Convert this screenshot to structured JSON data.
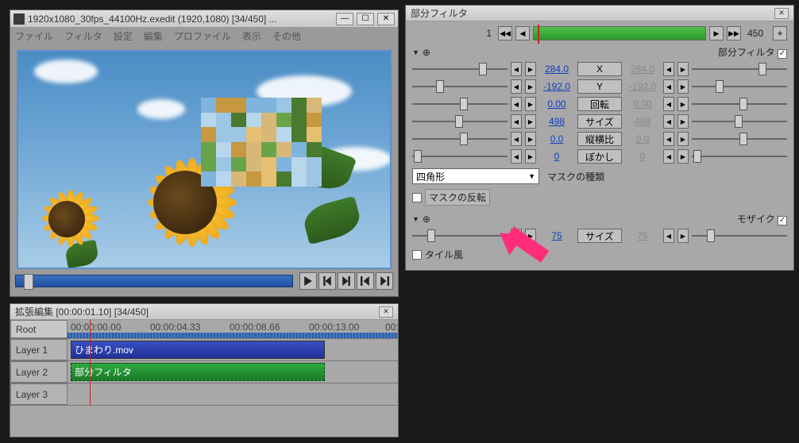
{
  "preview": {
    "title": "1920x1080_30fps_44100Hz.exedit (1920,1080) [34/450]  ...",
    "menu": [
      "ファイル",
      "フィルタ",
      "設定",
      "編集",
      "プロファイル",
      "表示",
      "その他"
    ]
  },
  "timeline": {
    "title": "拡張編集 [00:00:01.10] [34/450]",
    "root": "Root",
    "ticks": [
      "00:00:00.00",
      "00:00:04.33",
      "00:00:08.66",
      "00:00:13.00",
      "00:"
    ],
    "layers": [
      "Layer 1",
      "Layer 2",
      "Layer 3"
    ],
    "clip_video": "ひまわり.mov",
    "clip_filter": "部分フィルタ"
  },
  "filter": {
    "title": "部分フィルタ",
    "frame_start": "1",
    "frame_end": "450",
    "section1": "部分フィルタ",
    "mosaic_label": "モザイク",
    "params": [
      {
        "name": "X",
        "left": "284.0",
        "right": "284.0"
      },
      {
        "name": "Y",
        "left": "-192.0",
        "right": "-192.0"
      },
      {
        "name": "回転",
        "left": "0.00",
        "right": "0.00"
      },
      {
        "name": "サイズ",
        "left": "498",
        "right": "498"
      },
      {
        "name": "縦横比",
        "left": "0.0",
        "right": "0.0"
      },
      {
        "name": "ぼかし",
        "left": "0",
        "right": "0"
      }
    ],
    "mask_shape": "四角形",
    "mask_label": "マスクの種類",
    "invert": "マスクの反転",
    "size2": {
      "name": "サイズ",
      "left": "75",
      "right": "75"
    },
    "tile": "タイル風"
  }
}
